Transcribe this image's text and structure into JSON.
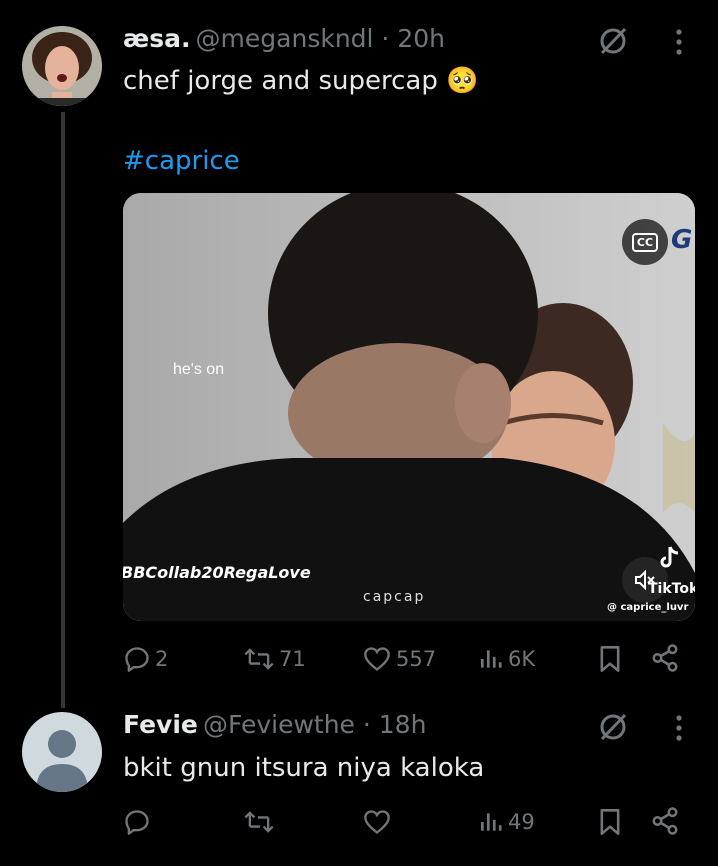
{
  "tweet1": {
    "display_name": "æsa.",
    "handle_time": "@megansknd​l · 20h",
    "text": "chef jorge and supercap",
    "emoji": "🥺",
    "hashtag": "#caprice",
    "media": {
      "overlay_caption": "he's on",
      "watermark_left": "BBCollab20RegaLove",
      "watermark_center": "capcap",
      "tiktok_label": "TikTok",
      "tiktok_user": "@ caprice_luvr",
      "cc_label": "CC",
      "corner_text": "G"
    },
    "actions": {
      "replies": "2",
      "reposts": "71",
      "likes": "557",
      "views": "6K"
    }
  },
  "tweet2": {
    "display_name": "Fevie",
    "handle_time": "@Feviewthe · 18h",
    "text": "bkit gnun itsura niya kaloka",
    "actions": {
      "views": "49"
    }
  },
  "colors": {
    "background": "#000000",
    "text": "#e7e9ea",
    "muted": "#71767b",
    "link": "#1d9bf0",
    "thread_line": "#333639"
  },
  "icons": [
    "grok-icon",
    "more-icon",
    "reply-icon",
    "repost-icon",
    "like-icon",
    "views-icon",
    "bookmark-icon",
    "share-icon",
    "cc-icon",
    "mute-icon",
    "tiktok-icon"
  ]
}
